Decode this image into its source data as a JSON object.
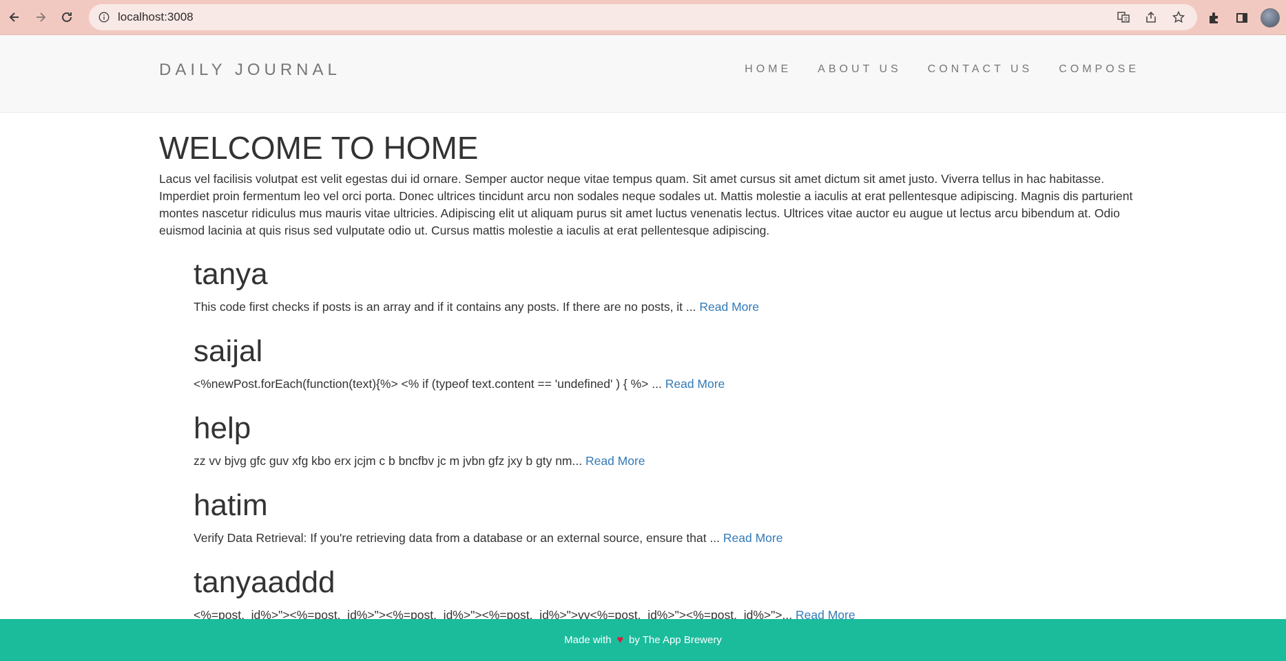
{
  "browser": {
    "url": "localhost:3008"
  },
  "site": {
    "brand": "DAILY JOURNAL",
    "nav": [
      "HOME",
      "ABOUT US",
      "CONTACT US",
      "COMPOSE"
    ]
  },
  "page": {
    "title": "WELCOME TO HOME",
    "intro": "Lacus vel facilisis volutpat est velit egestas dui id ornare. Semper auctor neque vitae tempus quam. Sit amet cursus sit amet dictum sit amet justo. Viverra tellus in hac habitasse. Imperdiet proin fermentum leo vel orci porta. Donec ultrices tincidunt arcu non sodales neque sodales ut. Mattis molestie a iaculis at erat pellentesque adipiscing. Magnis dis parturient montes nascetur ridiculus mus mauris vitae ultricies. Adipiscing elit ut aliquam purus sit amet luctus venenatis lectus. Ultrices vitae auctor eu augue ut lectus arcu bibendum at. Odio euismod lacinia at quis risus sed vulputate odio ut. Cursus mattis molestie a iaculis at erat pellentesque adipiscing."
  },
  "posts": [
    {
      "title": "tanya",
      "excerpt": "This code first checks if posts is an array and if it contains any posts. If there are no posts, it ...",
      "link": "Read More"
    },
    {
      "title": "saijal",
      "excerpt": "<%newPost.forEach(function(text){%> <% if (typeof text.content == 'undefined' ) { %> ...",
      "link": "Read More"
    },
    {
      "title": "help",
      "excerpt": "zz vv bjvg gfc guv xfg kbo erx jcjm c b bncfbv jc m jvbn gfz jxy b gty nm...",
      "link": "Read More"
    },
    {
      "title": "hatim",
      "excerpt": "Verify Data Retrieval: If you're retrieving data from a database or an external source, ensure that ...",
      "link": "Read More"
    },
    {
      "title": "tanyaaddd",
      "excerpt": "<%=post._id%>\"><%=post._id%>\"><%=post._id%>\"><%=post._id%>\">vv<%=post._id%>\"><%=post._id%>\">...",
      "link": "Read More"
    }
  ],
  "footer": {
    "before": "Made with",
    "heart": "♥",
    "after": "by The App Brewery"
  }
}
